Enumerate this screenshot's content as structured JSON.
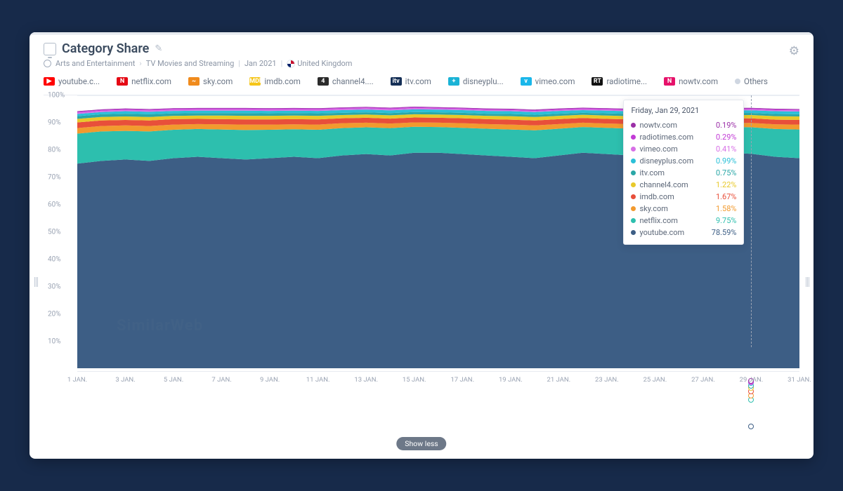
{
  "header": {
    "title": "Category Share",
    "breadcrumb_category": "Arts and Entertainment",
    "breadcrumb_subcategory": "TV Movies and Streaming",
    "period": "Jan 2021",
    "country": "United Kingdom"
  },
  "legend": [
    {
      "label": "youtube.c...",
      "color": "#ff0000",
      "text": "▶"
    },
    {
      "label": "netflix.com",
      "color": "#e50914",
      "text": "N"
    },
    {
      "label": "sky.com",
      "color": "#f08b1d",
      "text": "~"
    },
    {
      "label": "imdb.com",
      "color": "#f5c518",
      "text": "IMDb"
    },
    {
      "label": "channel4....",
      "color": "#2b2b2b",
      "text": "4"
    },
    {
      "label": "itv.com",
      "color": "#152f56",
      "text": "itv"
    },
    {
      "label": "disneyplu...",
      "color": "#1ab3d6",
      "text": "+"
    },
    {
      "label": "vimeo.com",
      "color": "#1ab7ea",
      "text": "v"
    },
    {
      "label": "radiotime...",
      "color": "#111",
      "text": "RT"
    },
    {
      "label": "nowtv.com",
      "color": "#e6126a",
      "text": "N"
    }
  ],
  "others_label": "Others",
  "showless": "Show less",
  "watermark": "SimilarWeb",
  "tooltip": {
    "title": "Friday, Jan 29, 2021",
    "rows": [
      {
        "name": "nowtv.com",
        "value": "0.19%",
        "color": "#9b2fa7"
      },
      {
        "name": "radiotimes.com",
        "value": "0.29%",
        "color": "#c23bd6"
      },
      {
        "name": "vimeo.com",
        "value": "0.41%",
        "color": "#d770e6"
      },
      {
        "name": "disneyplus.com",
        "value": "0.99%",
        "color": "#2bc0d8"
      },
      {
        "name": "itv.com",
        "value": "0.75%",
        "color": "#2aa7a7"
      },
      {
        "name": "channel4.com",
        "value": "1.22%",
        "color": "#e8c92b"
      },
      {
        "name": "imdb.com",
        "value": "1.67%",
        "color": "#e84f3a"
      },
      {
        "name": "sky.com",
        "value": "1.58%",
        "color": "#f29a2e"
      },
      {
        "name": "netflix.com",
        "value": "9.75%",
        "color": "#2dbfae"
      },
      {
        "name": "youtube.com",
        "value": "78.59%",
        "color": "#3d5e85"
      }
    ]
  },
  "chart_data": {
    "type": "area",
    "stacked": true,
    "xlabel": "",
    "ylabel": "",
    "ylim": [
      0,
      100
    ],
    "yticks": [
      "10%",
      "20%",
      "30%",
      "40%",
      "50%",
      "60%",
      "70%",
      "80%",
      "90%",
      "100%"
    ],
    "x": [
      1,
      2,
      3,
      4,
      5,
      6,
      7,
      8,
      9,
      10,
      11,
      12,
      13,
      14,
      15,
      16,
      17,
      18,
      19,
      20,
      21,
      22,
      23,
      24,
      25,
      26,
      27,
      28,
      29,
      30,
      31
    ],
    "xticks": [
      "1 JAN.",
      "3 JAN.",
      "5 JAN.",
      "7 JAN.",
      "9 JAN.",
      "11 JAN.",
      "13 JAN.",
      "15 JAN.",
      "17 JAN.",
      "19 JAN.",
      "21 JAN.",
      "23 JAN.",
      "25 JAN.",
      "27 JAN.",
      "29 JAN.",
      "31 JAN."
    ],
    "series": [
      {
        "name": "youtube.com",
        "color": "#3d5e85",
        "values": [
          75,
          76,
          76.5,
          76,
          77,
          77.5,
          77,
          76.5,
          77,
          77.5,
          77,
          78,
          78.5,
          78,
          79,
          79,
          78.5,
          78,
          77.5,
          77,
          78,
          79,
          78.5,
          78,
          79,
          80,
          79.5,
          79,
          78.59,
          77.5,
          77
        ]
      },
      {
        "name": "netflix.com",
        "color": "#2dbfae",
        "values": [
          11,
          10.8,
          10.5,
          10.8,
          10.4,
          10.2,
          10.5,
          10.8,
          10.4,
          10.1,
          10.4,
          10,
          9.8,
          10,
          9.5,
          9.4,
          9.6,
          9.8,
          10,
          10.2,
          9.8,
          9.4,
          9.6,
          9.8,
          9.4,
          9,
          9.2,
          9.4,
          9.75,
          10.2,
          10.5
        ]
      },
      {
        "name": "sky.com",
        "color": "#f29a2e",
        "values": [
          2,
          2,
          2,
          2,
          1.9,
          1.8,
          1.9,
          2,
          1.9,
          1.8,
          1.9,
          1.8,
          1.7,
          1.7,
          1.6,
          1.6,
          1.7,
          1.7,
          1.8,
          1.8,
          1.7,
          1.6,
          1.6,
          1.7,
          1.6,
          1.5,
          1.5,
          1.5,
          1.58,
          1.7,
          1.8
        ]
      },
      {
        "name": "imdb.com",
        "color": "#e84f3a",
        "values": [
          2.1,
          2,
          2,
          2,
          2,
          1.9,
          1.9,
          1.9,
          1.9,
          1.9,
          1.9,
          1.8,
          1.8,
          1.8,
          1.8,
          1.8,
          1.8,
          1.8,
          1.8,
          1.8,
          1.8,
          1.7,
          1.7,
          1.7,
          1.7,
          1.6,
          1.7,
          1.7,
          1.67,
          1.7,
          1.7
        ]
      },
      {
        "name": "channel4.com",
        "color": "#e8c92b",
        "values": [
          1.3,
          1.3,
          1.3,
          1.3,
          1.2,
          1.2,
          1.3,
          1.3,
          1.3,
          1.3,
          1.3,
          1.2,
          1.2,
          1.2,
          1.2,
          1.2,
          1.2,
          1.2,
          1.3,
          1.3,
          1.2,
          1.2,
          1.2,
          1.2,
          1.2,
          1.2,
          1.2,
          1.2,
          1.22,
          1.3,
          1.3
        ]
      },
      {
        "name": "itv.com",
        "color": "#2aa7a7",
        "values": [
          1,
          1,
          1,
          1,
          0.9,
          0.9,
          0.9,
          1,
          0.9,
          0.9,
          0.9,
          0.8,
          0.8,
          0.8,
          0.8,
          0.8,
          0.8,
          0.8,
          0.8,
          0.8,
          0.8,
          0.7,
          0.8,
          0.8,
          0.8,
          0.7,
          0.7,
          0.7,
          0.75,
          0.8,
          0.8
        ]
      },
      {
        "name": "disneyplus.com",
        "color": "#2bc0d8",
        "values": [
          0.8,
          0.8,
          0.9,
          0.9,
          0.9,
          0.9,
          0.9,
          0.9,
          0.9,
          0.9,
          0.9,
          1,
          1,
          1,
          1,
          1,
          1,
          1,
          1,
          1,
          1,
          1,
          1,
          1,
          1,
          1,
          1,
          1,
          0.99,
          1,
          1
        ]
      },
      {
        "name": "vimeo.com",
        "color": "#d770e6",
        "values": [
          0.5,
          0.5,
          0.5,
          0.5,
          0.5,
          0.5,
          0.5,
          0.5,
          0.5,
          0.5,
          0.5,
          0.5,
          0.5,
          0.5,
          0.5,
          0.4,
          0.4,
          0.4,
          0.4,
          0.4,
          0.4,
          0.4,
          0.4,
          0.4,
          0.4,
          0.4,
          0.4,
          0.4,
          0.41,
          0.4,
          0.4
        ]
      },
      {
        "name": "radiotimes.com",
        "color": "#c23bd6",
        "values": [
          0.3,
          0.3,
          0.3,
          0.3,
          0.3,
          0.3,
          0.3,
          0.3,
          0.3,
          0.3,
          0.3,
          0.3,
          0.3,
          0.3,
          0.3,
          0.3,
          0.3,
          0.3,
          0.3,
          0.3,
          0.3,
          0.3,
          0.3,
          0.3,
          0.3,
          0.3,
          0.3,
          0.3,
          0.29,
          0.3,
          0.3
        ]
      },
      {
        "name": "nowtv.com",
        "color": "#9b2fa7",
        "values": [
          0.2,
          0.2,
          0.2,
          0.2,
          0.2,
          0.2,
          0.2,
          0.2,
          0.2,
          0.2,
          0.2,
          0.2,
          0.2,
          0.2,
          0.2,
          0.2,
          0.2,
          0.2,
          0.2,
          0.2,
          0.2,
          0.2,
          0.2,
          0.2,
          0.2,
          0.2,
          0.2,
          0.2,
          0.19,
          0.2,
          0.2
        ]
      }
    ],
    "hover_index": 28
  }
}
